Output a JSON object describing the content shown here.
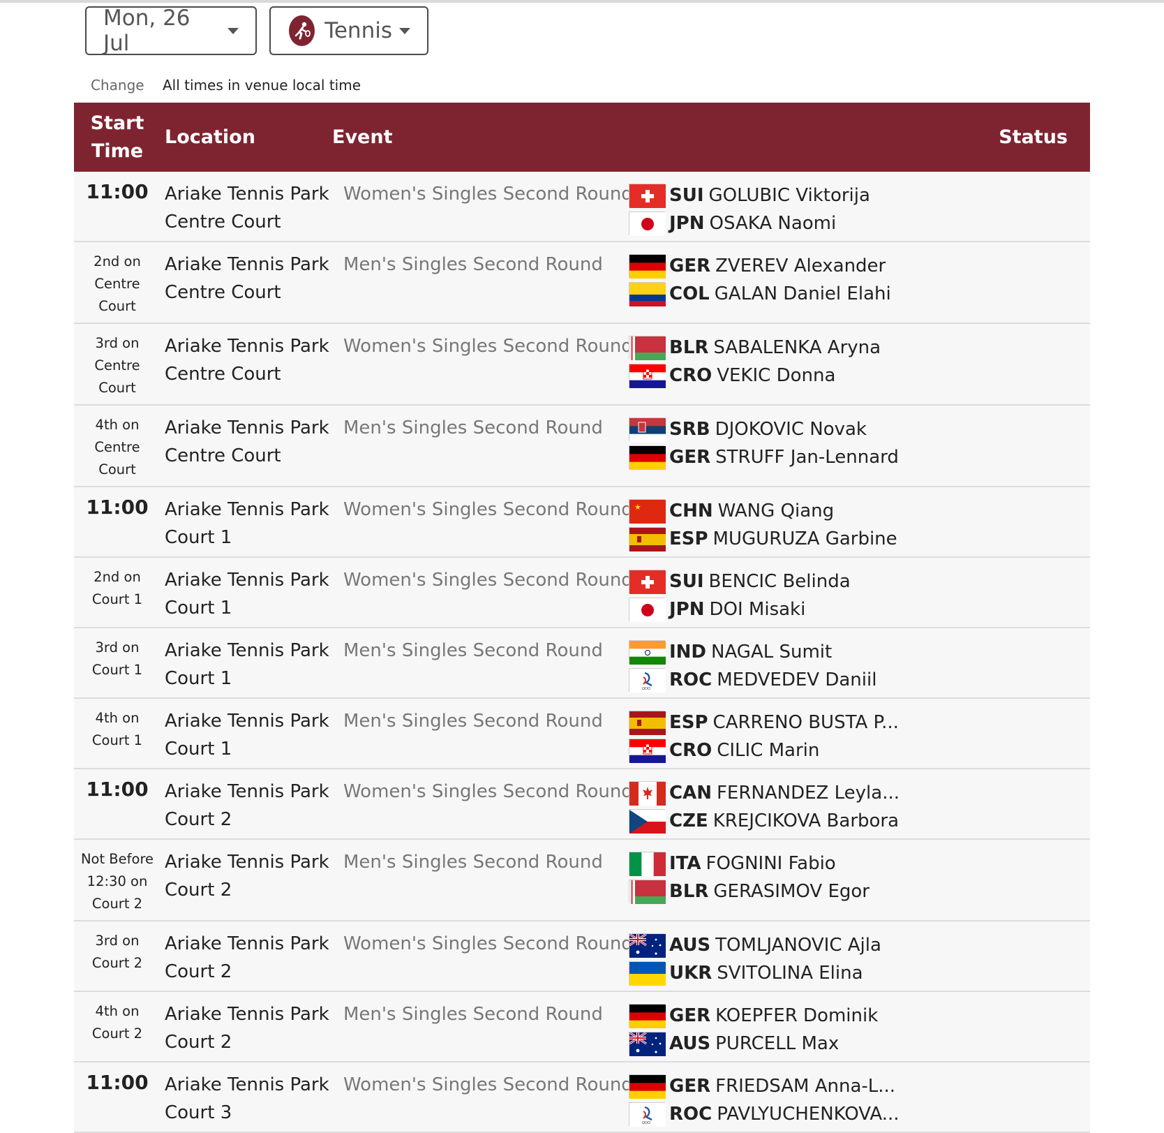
{
  "date_selector": {
    "label": "Mon, 26 Jul"
  },
  "sport_selector": {
    "label": "Tennis"
  },
  "change_label": "Change",
  "timezone_note": "All times in venue local time",
  "table": {
    "headers": {
      "start_line1": "Start",
      "start_line2": "Time",
      "location": "Location",
      "event": "Event",
      "status": "Status"
    },
    "rows": [
      {
        "start_main": "11:00",
        "start_note": [],
        "location": [
          "Ariake Tennis Park",
          "Centre Court"
        ],
        "event": "Women's Singles Second Round",
        "competitors": [
          {
            "noc": "SUI",
            "name": "GOLUBIC Viktorija",
            "flag": "SUI"
          },
          {
            "noc": "JPN",
            "name": "OSAKA Naomi",
            "flag": "JPN"
          }
        ]
      },
      {
        "start_main": "",
        "start_note": [
          "2nd on",
          "Centre",
          "Court"
        ],
        "location": [
          "Ariake Tennis Park",
          "Centre Court"
        ],
        "event": "Men's Singles Second Round",
        "competitors": [
          {
            "noc": "GER",
            "name": "ZVEREV Alexander",
            "flag": "GER"
          },
          {
            "noc": "COL",
            "name": "GALAN Daniel Elahi",
            "flag": "COL"
          }
        ]
      },
      {
        "start_main": "",
        "start_note": [
          "3rd on",
          "Centre",
          "Court"
        ],
        "location": [
          "Ariake Tennis Park",
          "Centre Court"
        ],
        "event": "Women's Singles Second Round",
        "competitors": [
          {
            "noc": "BLR",
            "name": "SABALENKA Aryna",
            "flag": "BLR"
          },
          {
            "noc": "CRO",
            "name": "VEKIC Donna",
            "flag": "CRO"
          }
        ]
      },
      {
        "start_main": "",
        "start_note": [
          "4th on",
          "Centre",
          "Court"
        ],
        "location": [
          "Ariake Tennis Park",
          "Centre Court"
        ],
        "event": "Men's Singles Second Round",
        "competitors": [
          {
            "noc": "SRB",
            "name": "DJOKOVIC Novak",
            "flag": "SRB"
          },
          {
            "noc": "GER",
            "name": "STRUFF Jan-Lennard",
            "flag": "GER"
          }
        ]
      },
      {
        "start_main": "11:00",
        "start_note": [],
        "location": [
          "Ariake Tennis Park",
          "Court 1"
        ],
        "event": "Women's Singles Second Round",
        "competitors": [
          {
            "noc": "CHN",
            "name": "WANG Qiang",
            "flag": "CHN"
          },
          {
            "noc": "ESP",
            "name": "MUGURUZA Garbine",
            "flag": "ESP"
          }
        ]
      },
      {
        "start_main": "",
        "start_note": [
          "2nd on",
          "Court 1"
        ],
        "location": [
          "Ariake Tennis Park",
          "Court 1"
        ],
        "event": "Women's Singles Second Round",
        "competitors": [
          {
            "noc": "SUI",
            "name": "BENCIC Belinda",
            "flag": "SUI"
          },
          {
            "noc": "JPN",
            "name": "DOI Misaki",
            "flag": "JPN"
          }
        ]
      },
      {
        "start_main": "",
        "start_note": [
          "3rd on",
          "Court 1"
        ],
        "location": [
          "Ariake Tennis Park",
          "Court 1"
        ],
        "event": "Men's Singles Second Round",
        "competitors": [
          {
            "noc": "IND",
            "name": "NAGAL Sumit",
            "flag": "IND"
          },
          {
            "noc": "ROC",
            "name": "MEDVEDEV Daniil",
            "flag": "ROC"
          }
        ]
      },
      {
        "start_main": "",
        "start_note": [
          "4th on",
          "Court 1"
        ],
        "location": [
          "Ariake Tennis Park",
          "Court 1"
        ],
        "event": "Men's Singles Second Round",
        "competitors": [
          {
            "noc": "ESP",
            "name": "CARRENO BUSTA P...",
            "flag": "ESP"
          },
          {
            "noc": "CRO",
            "name": "CILIC Marin",
            "flag": "CRO"
          }
        ]
      },
      {
        "start_main": "11:00",
        "start_note": [],
        "location": [
          "Ariake Tennis Park",
          "Court 2"
        ],
        "event": "Women's Singles Second Round",
        "competitors": [
          {
            "noc": "CAN",
            "name": "FERNANDEZ Leyla...",
            "flag": "CAN"
          },
          {
            "noc": "CZE",
            "name": "KREJCIKOVA Barbora",
            "flag": "CZE"
          }
        ]
      },
      {
        "start_main": "",
        "start_note": [
          "Not Before",
          "12:30 on",
          "Court 2"
        ],
        "location": [
          "Ariake Tennis Park",
          "Court 2"
        ],
        "event": "Men's Singles Second Round",
        "competitors": [
          {
            "noc": "ITA",
            "name": "FOGNINI Fabio",
            "flag": "ITA"
          },
          {
            "noc": "BLR",
            "name": "GERASIMOV Egor",
            "flag": "BLR"
          }
        ]
      },
      {
        "start_main": "",
        "start_note": [
          "3rd on",
          "Court 2"
        ],
        "location": [
          "Ariake Tennis Park",
          "Court 2"
        ],
        "event": "Women's Singles Second Round",
        "competitors": [
          {
            "noc": "AUS",
            "name": "TOMLJANOVIC Ajla",
            "flag": "AUS"
          },
          {
            "noc": "UKR",
            "name": "SVITOLINA Elina",
            "flag": "UKR"
          }
        ]
      },
      {
        "start_main": "",
        "start_note": [
          "4th on",
          "Court 2"
        ],
        "location": [
          "Ariake Tennis Park",
          "Court 2"
        ],
        "event": "Men's Singles Second Round",
        "competitors": [
          {
            "noc": "GER",
            "name": "KOEPFER Dominik",
            "flag": "GER"
          },
          {
            "noc": "AUS",
            "name": "PURCELL Max",
            "flag": "AUS"
          }
        ]
      },
      {
        "start_main": "11:00",
        "start_note": [],
        "location": [
          "Ariake Tennis Park",
          "Court 3"
        ],
        "event": "Women's Singles Second Round",
        "competitors": [
          {
            "noc": "GER",
            "name": "FRIEDSAM Anna-L...",
            "flag": "GER"
          },
          {
            "noc": "ROC",
            "name": "PAVLYUCHENKOVA...",
            "flag": "ROC"
          }
        ]
      }
    ]
  },
  "colors": {
    "header_bg": "#7e2430",
    "row_bg": "#f7f7f7",
    "event_text": "#777777"
  },
  "icons": {
    "sport_icon": "tennis-player-icon",
    "dropdown": "caret-down-icon"
  }
}
